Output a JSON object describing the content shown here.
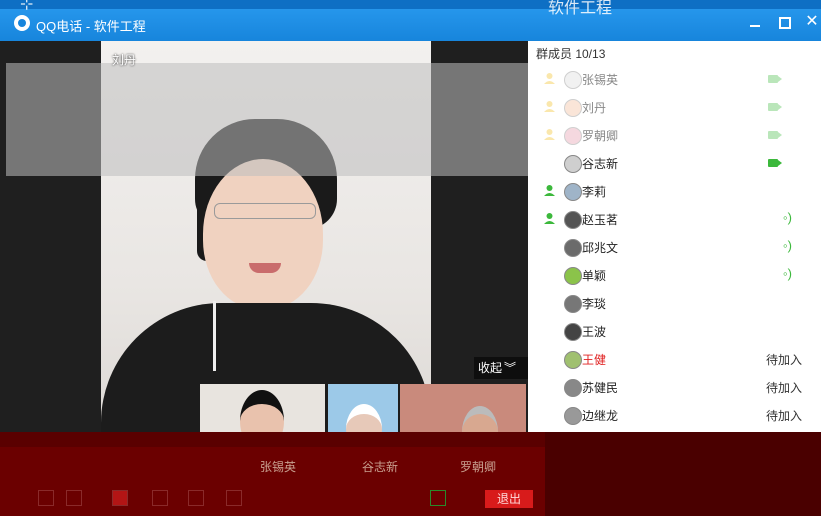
{
  "window": {
    "background_title": "软件工程",
    "title": "QQ电话 - 软件工程"
  },
  "main_video": {
    "label": "刘丹",
    "collapse_label": "收起"
  },
  "roster": {
    "header": "群成员 10/13",
    "members": [
      {
        "name": "张锡英",
        "admin": true,
        "icon": "camera-icon",
        "faded": true
      },
      {
        "name": "刘丹",
        "admin": true,
        "icon": "camera-icon",
        "faded": true
      },
      {
        "name": "罗朝卿",
        "admin": true,
        "icon": "camera-icon",
        "faded": true
      },
      {
        "name": "谷志新",
        "admin": false,
        "icon": "camera-icon",
        "faded": false
      },
      {
        "name": "李莉",
        "admin": true,
        "icon": "",
        "faded": false
      },
      {
        "name": "赵玉茗",
        "admin": true,
        "icon": "speaker-icon",
        "faded": false
      },
      {
        "name": "邱兆文",
        "admin": false,
        "icon": "speaker-icon",
        "faded": false
      },
      {
        "name": "单颖",
        "admin": false,
        "icon": "speaker-icon",
        "faded": false
      },
      {
        "name": "李琰",
        "admin": false,
        "icon": "",
        "faded": false
      },
      {
        "name": "王波",
        "admin": false,
        "icon": "",
        "faded": false
      },
      {
        "name": "王健",
        "admin": false,
        "icon": "",
        "status": "待加入",
        "red": true
      },
      {
        "name": "苏健民",
        "admin": false,
        "icon": "",
        "status": "待加入"
      },
      {
        "name": "边继龙",
        "admin": false,
        "icon": "",
        "status": "待加入"
      }
    ]
  },
  "thumbnails": {
    "labels": [
      "张锡英",
      "谷志新",
      "罗朝卿"
    ]
  },
  "controls": {
    "exit_label": "退出"
  },
  "colors": {
    "accent": "#1785dc",
    "online_green": "#3cb83c",
    "exit_red": "#d81b1b"
  }
}
